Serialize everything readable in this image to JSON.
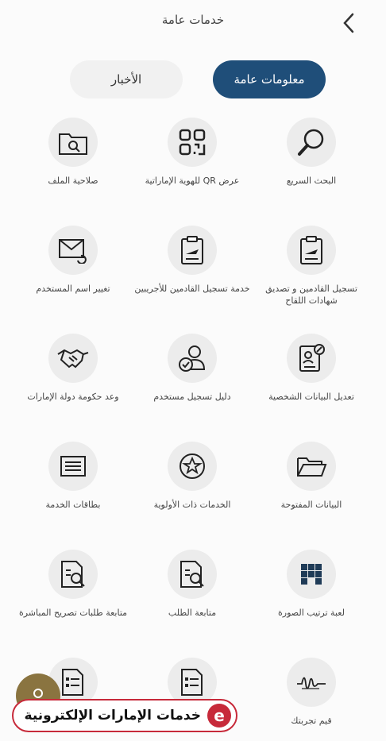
{
  "header": {
    "title": "خدمات عامة"
  },
  "tabs": [
    {
      "label": "معلومات عامة",
      "active": true
    },
    {
      "label": "الأخبار",
      "active": false
    }
  ],
  "tiles": [
    {
      "label": "البحث السريع",
      "icon": "magnifier-icon"
    },
    {
      "label": "عرض QR للهوية الإماراتية",
      "icon": "qr-code-icon"
    },
    {
      "label": "صلاحية الملف",
      "icon": "folder-search-icon"
    },
    {
      "label": "تسجيل القادمين و تصديق شهادات اللقاح",
      "icon": "clipboard-plane-icon"
    },
    {
      "label": "خدمة تسجيل القادمين للأجريبين",
      "icon": "clipboard-plane-icon"
    },
    {
      "label": "تغيير اسم المستخدم",
      "icon": "envelope-refresh-icon"
    },
    {
      "label": "تعديل البيانات الشخصية",
      "icon": "id-card-edit-icon"
    },
    {
      "label": "دليل تسجيل مستخدم",
      "icon": "user-check-icon"
    },
    {
      "label": "وعد حكومة دولة الإمارات",
      "icon": "handshake-icon"
    },
    {
      "label": "البيانات المفتوحة",
      "icon": "open-folder-icon"
    },
    {
      "label": "الخدمات ذات الأولوية",
      "icon": "star-circle-icon"
    },
    {
      "label": "بطاقات الخدمة",
      "icon": "card-lines-icon"
    },
    {
      "label": "لعبة ترتيب الصورة",
      "icon": "puzzle-grid-icon"
    },
    {
      "label": "متابعة الطلب",
      "icon": "document-search-icon"
    },
    {
      "label": "متابعة طلبات تصريح المباشرة",
      "icon": "document-search-icon"
    },
    {
      "label": "قيم تجربتك",
      "icon": "signature-icon"
    },
    {
      "label": "",
      "icon": "document-list-icon"
    },
    {
      "label": "",
      "icon": "document-list-icon"
    }
  ],
  "banner": {
    "text": "خدمات الإمارات الإلكترونية",
    "logo": "e"
  },
  "colors": {
    "primary": "#1f4e79",
    "tile_bg": "#ececec",
    "banner_red": "#c72a3a"
  }
}
